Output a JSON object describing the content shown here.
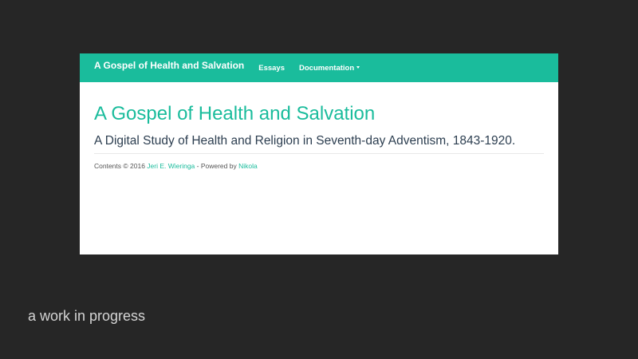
{
  "navbar": {
    "brand": "A Gospel of Health and Salvation",
    "items": [
      {
        "label": "Essays"
      },
      {
        "label": "Documentation",
        "has_dropdown": true
      }
    ]
  },
  "main": {
    "title": "A Gospel of Health and Salvation",
    "subtitle": "A Digital Study of Health and Religion in Seventh-day Adventism, 1843-1920."
  },
  "footer": {
    "prefix": "Contents © 2016 ",
    "author_link": "Jeri E. Wieringa",
    "middle": " - Powered by ",
    "engine_link": "Nikola"
  },
  "caption": "a work in progress",
  "colors": {
    "accent": "#1abc9c",
    "background": "#262626",
    "heading_dark": "#2c3e50"
  }
}
